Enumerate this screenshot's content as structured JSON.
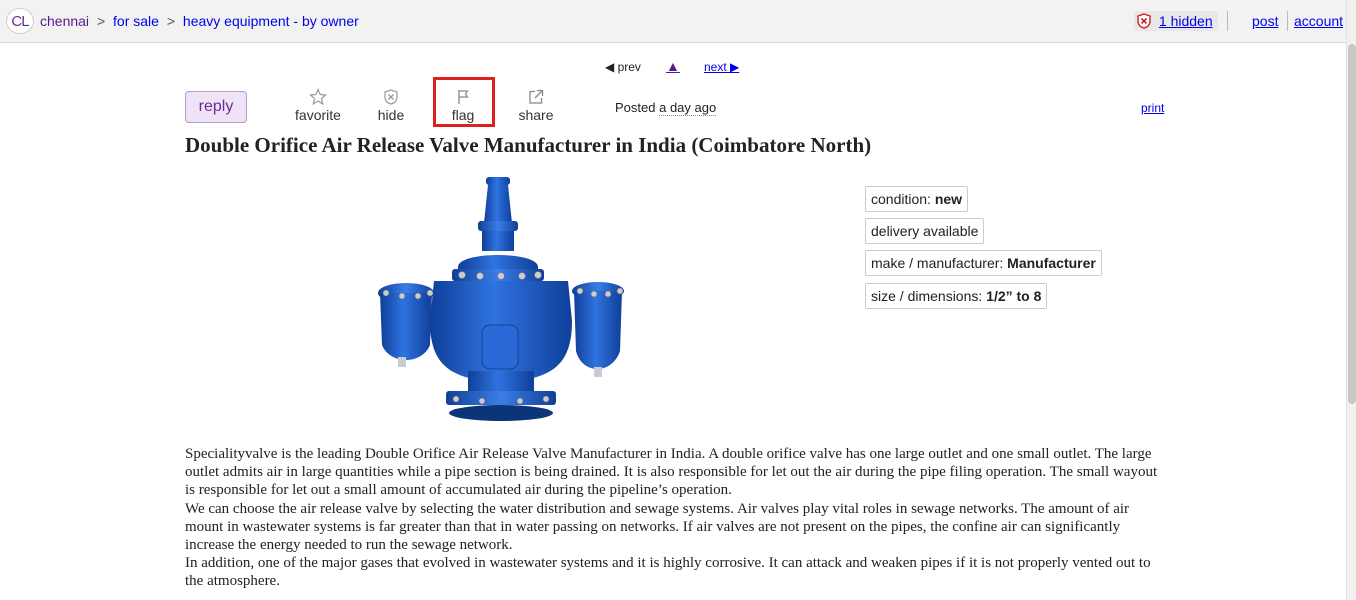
{
  "header": {
    "logo": "CL",
    "breadcrumb": [
      {
        "label": "chennai"
      },
      {
        "label": "for sale"
      },
      {
        "label": "heavy equipment - by owner"
      }
    ],
    "separator": ">",
    "hidden_label": "1 hidden",
    "post_label": "post",
    "account_label": "account"
  },
  "nav": {
    "prev_label": "prev",
    "prev_glyph": "◀",
    "up_glyph": "▲",
    "next_label": "next",
    "next_glyph": "▶"
  },
  "actions": {
    "reply_label": "reply",
    "favorite_label": "favorite",
    "hide_label": "hide",
    "flag_label": "flag",
    "share_label": "share",
    "posted_prefix": "Posted",
    "posted_ago": "a day ago",
    "print_label": "print"
  },
  "post": {
    "title": "Double Orifice Air Release Valve Manufacturer in India (Coimbatore North)",
    "attributes": [
      {
        "key": "condition: ",
        "value": "new"
      },
      {
        "key": "delivery available",
        "value": ""
      },
      {
        "key": "make / manufacturer: ",
        "value": "Manufacturer"
      },
      {
        "key": "size / dimensions: ",
        "value": "1/2” to 8"
      }
    ],
    "body": [
      "Specialityvalve is the leading Double Orifice Air Release Valve Manufacturer in India. A double orifice valve has one large outlet and one small outlet. The large outlet admits air in large quantities while a pipe section is being drained. It is also responsible for let out the air during the pipe filing operation. The small wayout is responsible for let out a small amount of accumulated air during the pipeline’s operation.",
      "We can choose the air release valve by selecting the water distribution and sewage systems. Air valves play vital roles in sewage networks. The amount of air mount in wastewater systems is far greater than that in water passing on networks. If air valves are not present on the pipes, the confine air can significantly increase the energy needed to run the sewage network.",
      "In addition, one of the major gases that evolved in wastewater systems and it is highly corrosive. It can attack and weaken pipes if it is not properly vented out to the atmosphere."
    ]
  },
  "colors": {
    "accent_purple": "#6a2c91",
    "link_blue": "#0000ee",
    "highlight_red": "#e02020",
    "valve_blue": "#1f5fc8"
  },
  "icons": {
    "favorite": "star-icon",
    "hide": "hide-icon",
    "flag": "flag-icon",
    "share": "share-icon",
    "hidden": "hidden-shield-icon"
  }
}
